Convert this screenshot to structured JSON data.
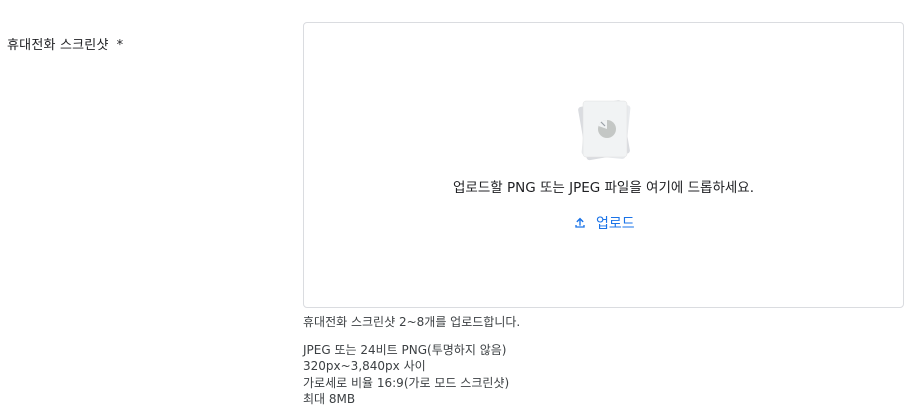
{
  "field": {
    "label": "휴대전화 스크린샷",
    "required_marker": "*"
  },
  "dropzone": {
    "illustration_icon": "image-stack-placeholder-icon",
    "drop_text": "업로드할 PNG 또는 JPEG 파일을 여기에 드롭하세요.",
    "upload_button": {
      "icon": "upload-icon",
      "label": "업로드"
    },
    "accent_color": "#1a73e8",
    "border_color": "#dadce0"
  },
  "helper": {
    "count_text": "휴대전화 스크린샷 2~8개를 업로드합니다.",
    "requirements": [
      "JPEG 또는 24비트 PNG(투명하지 않음)",
      "320px~3,840px 사이",
      "가로세로 비율 16:9(가로 모드 스크린샷)",
      "최대 8MB"
    ]
  }
}
